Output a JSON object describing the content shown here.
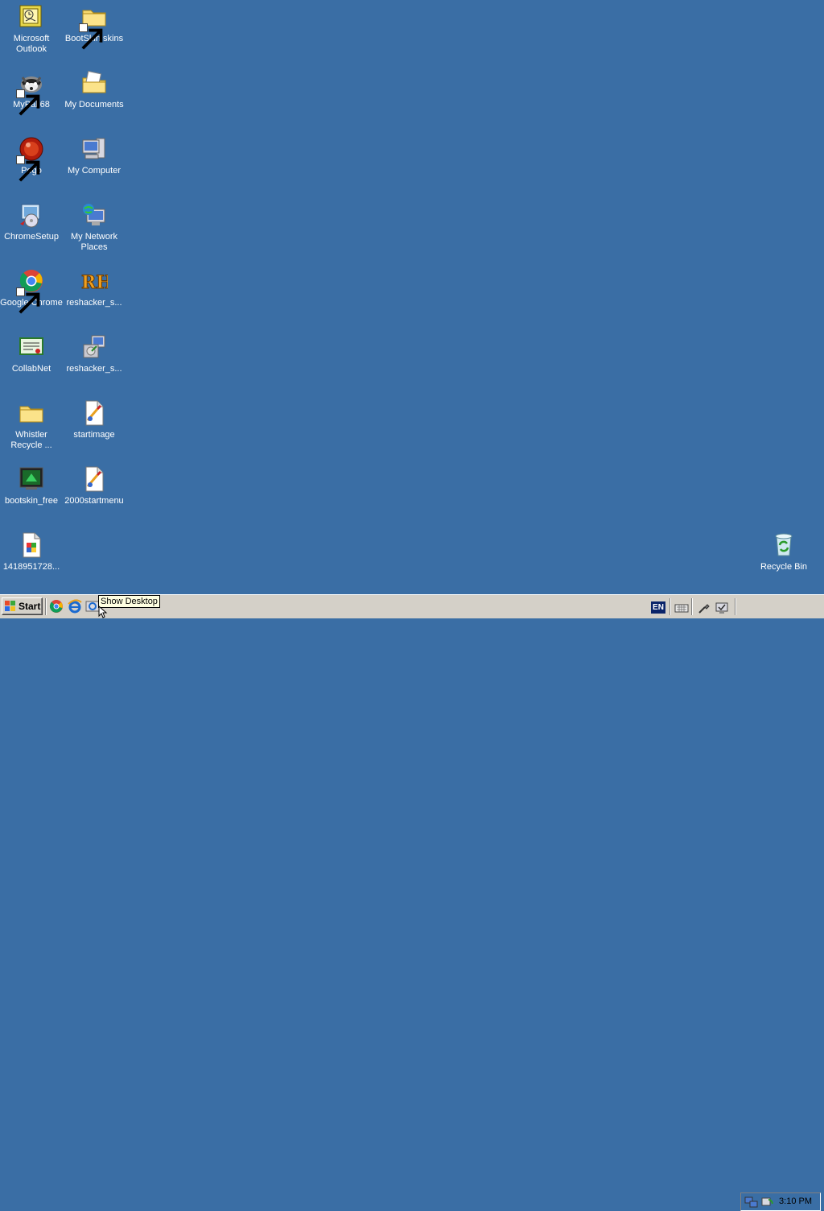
{
  "desktop": {
    "background": "#3a6ea5",
    "icons": [
      {
        "label": "Microsoft Outlook",
        "icon": "outlook-icon",
        "shortcut": false
      },
      {
        "label": "BootSkin skins",
        "icon": "folder-icon",
        "shortcut": true
      },
      {
        "label": "MyPal 68",
        "icon": "mypal-raccoon-icon",
        "shortcut": true
      },
      {
        "label": "My Documents",
        "icon": "my-documents-icon",
        "shortcut": false
      },
      {
        "label": "Pego",
        "icon": "pego-icon",
        "shortcut": true
      },
      {
        "label": "My Computer",
        "icon": "my-computer-icon",
        "shortcut": false
      },
      {
        "label": "ChromeSetup",
        "icon": "setup-installer-icon",
        "shortcut": false
      },
      {
        "label": "My Network Places",
        "icon": "network-places-icon",
        "shortcut": false
      },
      {
        "label": "Google Chrome",
        "icon": "chrome-icon",
        "shortcut": true
      },
      {
        "label": "reshacker_s...",
        "icon": "resource-hacker-icon",
        "shortcut": false
      },
      {
        "label": "CollabNet",
        "icon": "certificate-icon",
        "shortcut": false
      },
      {
        "label": "reshacker_s...",
        "icon": "installer-package-icon",
        "shortcut": false
      },
      {
        "label": "Whistler Recycle ...",
        "icon": "folder-icon",
        "shortcut": false
      },
      {
        "label": "startimage",
        "icon": "image-file-icon",
        "shortcut": false
      },
      {
        "label": "bootskin_free",
        "icon": "bootskin-icon",
        "shortcut": false
      },
      {
        "label": "2000startmenu",
        "icon": "image-file-icon",
        "shortcut": false
      },
      {
        "label": "1418951728...",
        "icon": "image-file-icon",
        "shortcut": false
      },
      {
        "label": "Recycle Bin",
        "icon": "recycle-bin-icon",
        "shortcut": false
      }
    ]
  },
  "taskbar": {
    "start_label": "Start",
    "quick_launch": [
      "chrome-icon",
      "internet-explorer-icon",
      "show-desktop-icon"
    ],
    "tooltip": "Show Desktop",
    "language": "EN",
    "tray_icons": [
      "keyboard-icon",
      "connection-icon",
      "monitor-check-icon",
      "network-icon",
      "sync-icon"
    ],
    "clock": "3:10 PM"
  }
}
